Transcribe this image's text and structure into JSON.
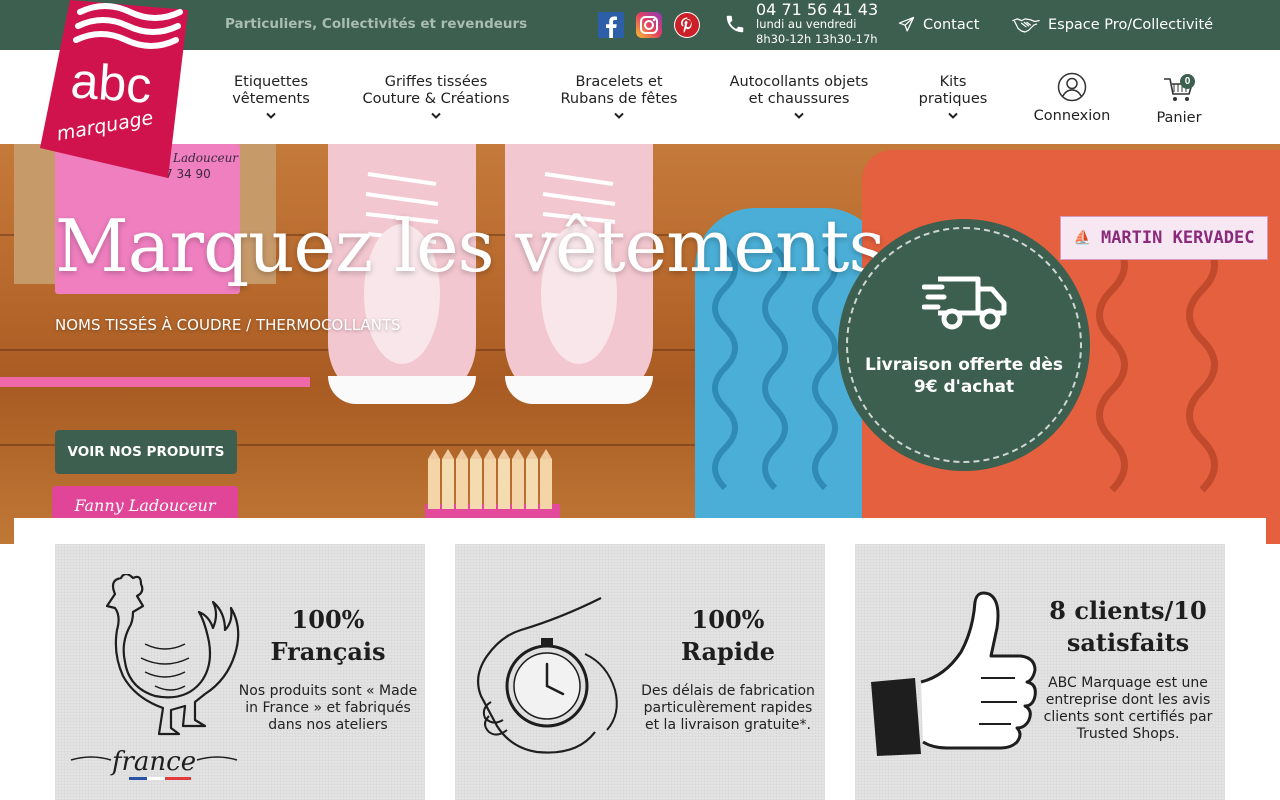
{
  "topbar": {
    "tagline": "Particuliers, Collectivités et revendeurs",
    "phone": "04 71 56 41 43",
    "hours_days": "lundi au vendredi",
    "hours_time": "8h30-12h 13h30-17h",
    "contact": "Contact",
    "pro_space": "Espace Pro/Collectivité",
    "social": [
      "facebook-icon",
      "instagram-icon",
      "pinterest-icon"
    ]
  },
  "logo": {
    "line1": "abc",
    "line2": "marquage"
  },
  "nav": {
    "items": [
      {
        "line1": "Etiquettes",
        "line2": "vêtements"
      },
      {
        "line1": "Griffes tissées",
        "line2": "Couture & Créations"
      },
      {
        "line1": "Bracelets et",
        "line2": "Rubans de fêtes"
      },
      {
        "line1": "Autocollants objets",
        "line2": "et chaussures"
      },
      {
        "line1": "Kits",
        "line2": "pratiques"
      }
    ],
    "login": "Connexion",
    "cart": "Panier",
    "cart_count": "0"
  },
  "hero": {
    "title": "Marquez les vêtements",
    "subtitle": "NOMS TISSÉS À COUDRE / THERMOCOLLANTS",
    "button": "VOIR NOS PRODUITS",
    "badge_line1": "Livraison offerte dès",
    "badge_line2": "9€ d'achat",
    "tag_text": "MARTIN KERVADEC",
    "name_tag": "Fanny Ladouceur"
  },
  "features": [
    {
      "title1": "100%",
      "title2": "Français",
      "desc": [
        "Nos produits sont « Made",
        "in France » et fabriqués",
        "dans nos ateliers"
      ],
      "signature": "france"
    },
    {
      "title1": "100%",
      "title2": "Rapide",
      "desc": [
        "Des délais de fabrication",
        "particulèrement rapides",
        "et la livraison gratuite*."
      ]
    },
    {
      "title1": "8 clients/10",
      "title2": "satisfaits",
      "desc": [
        "ABC Marquage est une",
        "entreprise dont les avis",
        "clients sont certifiés par",
        "Trusted Shops."
      ]
    }
  ],
  "colors": {
    "brand_green": "#3d5f4f",
    "brand_red": "#d0134c"
  }
}
